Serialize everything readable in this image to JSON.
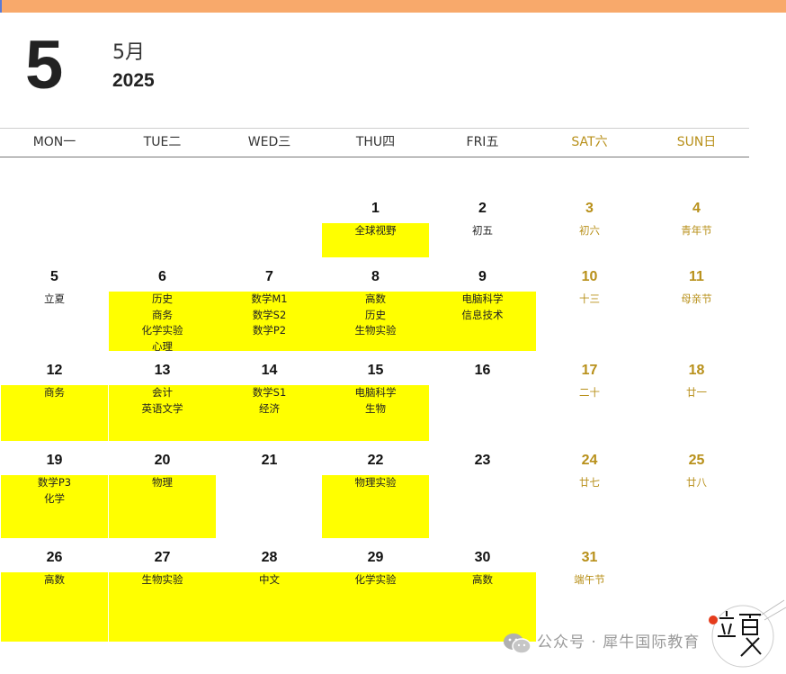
{
  "calendar": {
    "day_number": "5",
    "month_label": "5月",
    "year": "2025",
    "weekdays": [
      {
        "label": "MON一",
        "weekend": false
      },
      {
        "label": "TUE二",
        "weekend": false
      },
      {
        "label": "WED三",
        "weekend": false
      },
      {
        "label": "THU四",
        "weekend": false
      },
      {
        "label": "FRI五",
        "weekend": false
      },
      {
        "label": "SAT六",
        "weekend": true
      },
      {
        "label": "SUN日",
        "weekend": true
      }
    ],
    "weeks": [
      [
        null,
        null,
        null,
        {
          "day": "1",
          "lines": [
            "全球视野"
          ],
          "highlight": true
        },
        {
          "day": "2",
          "lines": [
            "初五"
          ],
          "highlight": false
        },
        {
          "day": "3",
          "lines": [
            "初六"
          ],
          "highlight": false
        },
        {
          "day": "4",
          "lines": [
            "青年节"
          ],
          "highlight": false
        }
      ],
      [
        {
          "day": "5",
          "lines": [
            "立夏"
          ],
          "highlight": false
        },
        {
          "day": "6",
          "lines": [
            "历史",
            "商务",
            "化学实验",
            "心理"
          ],
          "highlight": true
        },
        {
          "day": "7",
          "lines": [
            "数学M1",
            "数学S2",
            "数学P2"
          ],
          "highlight": true
        },
        {
          "day": "8",
          "lines": [
            "高数",
            "历史",
            "生物实验"
          ],
          "highlight": true
        },
        {
          "day": "9",
          "lines": [
            "电脑科学",
            "信息技术"
          ],
          "highlight": true
        },
        {
          "day": "10",
          "lines": [
            "十三"
          ],
          "highlight": false
        },
        {
          "day": "11",
          "lines": [
            "母亲节"
          ],
          "highlight": false
        }
      ],
      [
        {
          "day": "12",
          "lines": [
            "商务"
          ],
          "highlight": true
        },
        {
          "day": "13",
          "lines": [
            "会计",
            "英语文学"
          ],
          "highlight": true
        },
        {
          "day": "14",
          "lines": [
            "数学S1",
            "经济"
          ],
          "highlight": true
        },
        {
          "day": "15",
          "lines": [
            "电脑科学",
            "生物"
          ],
          "highlight": true
        },
        {
          "day": "16",
          "lines": [],
          "highlight": false
        },
        {
          "day": "17",
          "lines": [
            "二十"
          ],
          "highlight": false
        },
        {
          "day": "18",
          "lines": [
            "廿一"
          ],
          "highlight": false
        }
      ],
      [
        {
          "day": "19",
          "lines": [
            "数学P3",
            "化学"
          ],
          "highlight": true
        },
        {
          "day": "20",
          "lines": [
            "物理"
          ],
          "highlight": true
        },
        {
          "day": "21",
          "lines": [],
          "highlight": false
        },
        {
          "day": "22",
          "lines": [
            "物理实验"
          ],
          "highlight": true
        },
        {
          "day": "23",
          "lines": [],
          "highlight": false
        },
        {
          "day": "24",
          "lines": [
            "廿七"
          ],
          "highlight": false
        },
        {
          "day": "25",
          "lines": [
            "廿八"
          ],
          "highlight": false
        }
      ],
      [
        {
          "day": "26",
          "lines": [
            "高数"
          ],
          "highlight": true
        },
        {
          "day": "27",
          "lines": [
            "生物实验"
          ],
          "highlight": true
        },
        {
          "day": "28",
          "lines": [
            "中文"
          ],
          "highlight": true
        },
        {
          "day": "29",
          "lines": [
            "化学实验"
          ],
          "highlight": true
        },
        {
          "day": "30",
          "lines": [
            "高数"
          ],
          "highlight": true
        },
        {
          "day": "31",
          "lines": [
            "端午节"
          ],
          "highlight": false
        },
        null
      ]
    ]
  },
  "watermark": {
    "icon": "wechat-icon",
    "text": "公众号 · 犀牛国际教育",
    "seal_text": "立夏"
  },
  "colors": {
    "top_bar": "#f8a96b",
    "highlight": "#ffff00",
    "weekend": "#b8901a",
    "seal_dot": "#e53c1c"
  }
}
